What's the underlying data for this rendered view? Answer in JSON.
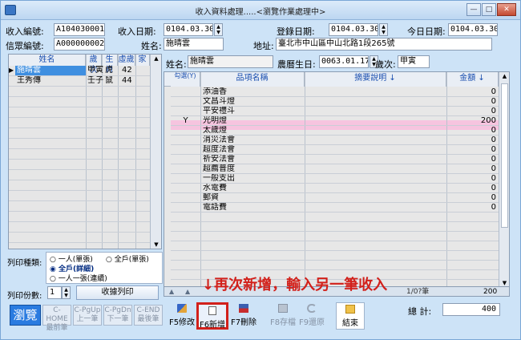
{
  "window": {
    "title": "收入資料處理.....<瀏覽作業處理中>"
  },
  "header": {
    "receipt_no_label": "收入編號:",
    "receipt_no": "A104030001",
    "income_date_label": "收入日期:",
    "income_date": "0104.03.30",
    "reg_date_label": "登錄日期:",
    "reg_date": "0104.03.30",
    "today_label": "今日日期:",
    "today": "0104.03.30",
    "member_no_label": "信眾編號:",
    "member_no": "A000000002",
    "name_label": "姓名:",
    "name": "施晴雲",
    "address_label": "地址:",
    "address": "臺北市中山區中山北路1段265號"
  },
  "member_list": {
    "columns": [
      "姓名",
      "歲次",
      "生肖",
      "虛歲",
      "家"
    ],
    "rows": [
      {
        "name": "施晴雲",
        "year": "甲寅",
        "zodiac": "虎",
        "age": "42"
      },
      {
        "name": "王秀傳",
        "year": "壬子",
        "zodiac": "鼠",
        "age": "44"
      }
    ]
  },
  "print_options": {
    "type_label": "列印種類:",
    "opt_single": "一人(單張)",
    "opt_household_single": "全戶(單張)",
    "opt_household_detail": "全戶(詳細)",
    "opt_single_cont": "一人一張(連續)",
    "copies_label": "列印份數:",
    "copies": "1",
    "print_button": "收據列印"
  },
  "detail": {
    "name_label": "姓名:",
    "name": "施晴雲",
    "lunar_label": "農曆生日:",
    "lunar_birth": "0063.01.17",
    "year_label": "歲次:",
    "year": "甲寅",
    "col_check": "勾選(Y)",
    "col_item": "品項名稱",
    "col_desc": "摘要說明 ↓",
    "col_amount": "金額 ↓",
    "items": [
      {
        "check": "",
        "name": "添油香",
        "amount": "0"
      },
      {
        "check": "",
        "name": "文昌斗燈",
        "amount": "0"
      },
      {
        "check": "",
        "name": "平安禮斗",
        "amount": "0"
      },
      {
        "check": "Y",
        "name": "光明燈",
        "amount": "200"
      },
      {
        "check": "",
        "name": "太歲燈",
        "amount": "0"
      },
      {
        "check": "",
        "name": "消災法會",
        "amount": "0"
      },
      {
        "check": "",
        "name": "超度法會",
        "amount": "0"
      },
      {
        "check": "",
        "name": "祈安法會",
        "amount": "0"
      },
      {
        "check": "",
        "name": "超薦普度",
        "amount": "0"
      },
      {
        "check": "",
        "name": "一般支出",
        "amount": "0"
      },
      {
        "check": "",
        "name": "水電費",
        "amount": "0"
      },
      {
        "check": "",
        "name": "郵資",
        "amount": "0"
      },
      {
        "check": "",
        "name": "電話費",
        "amount": "0"
      }
    ],
    "record_info": "1/0?筆",
    "sum_value": "200"
  },
  "footer": {
    "browse": "瀏覽",
    "nav": [
      "C-HOME 最前筆",
      "C-PgUp 上一筆",
      "C-PgDn 下一筆",
      "C-END 最後筆"
    ],
    "f5": "F5修改",
    "f6": "F6新增",
    "f7": "F7刪除",
    "f8": "F8存檔",
    "f9": "F9還原",
    "exit": "結束",
    "total_label": "總  計:",
    "total": "400"
  },
  "overlay_text": "↓再次新增，輸入另一筆收入",
  "colors": {
    "highlight_row": "#f6c4df",
    "selected_row": "#3f8fe0",
    "annotation": "#d2201a",
    "window_bg": "#cde3f7"
  }
}
